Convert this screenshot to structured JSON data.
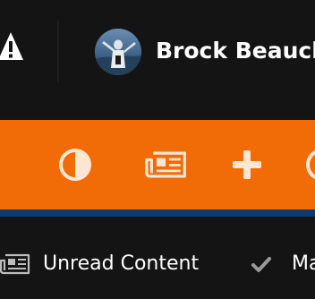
{
  "user_bar": {
    "user_name": "Brock Beauchamp",
    "alert_icon": "warning-triangle-icon",
    "avatar_icon": "user-avatar-photo"
  },
  "toolbar": {
    "buttons": [
      {
        "icon": "theme-contrast-icon"
      },
      {
        "icon": "newspaper-icon"
      },
      {
        "icon": "plus-icon"
      },
      {
        "icon": "clock-icon"
      }
    ]
  },
  "bottom_nav": {
    "unread_label": "Unread Content",
    "unread_icon": "newspaper-icon",
    "mark_label": "Mark site read",
    "mark_icon": "checkmark-icon"
  },
  "colors": {
    "background": "#141414",
    "accent_orange": "#f16b06",
    "accent_blue": "#0c3b73",
    "text": "#ffffff",
    "icon_muted": "#bdbdbd"
  }
}
